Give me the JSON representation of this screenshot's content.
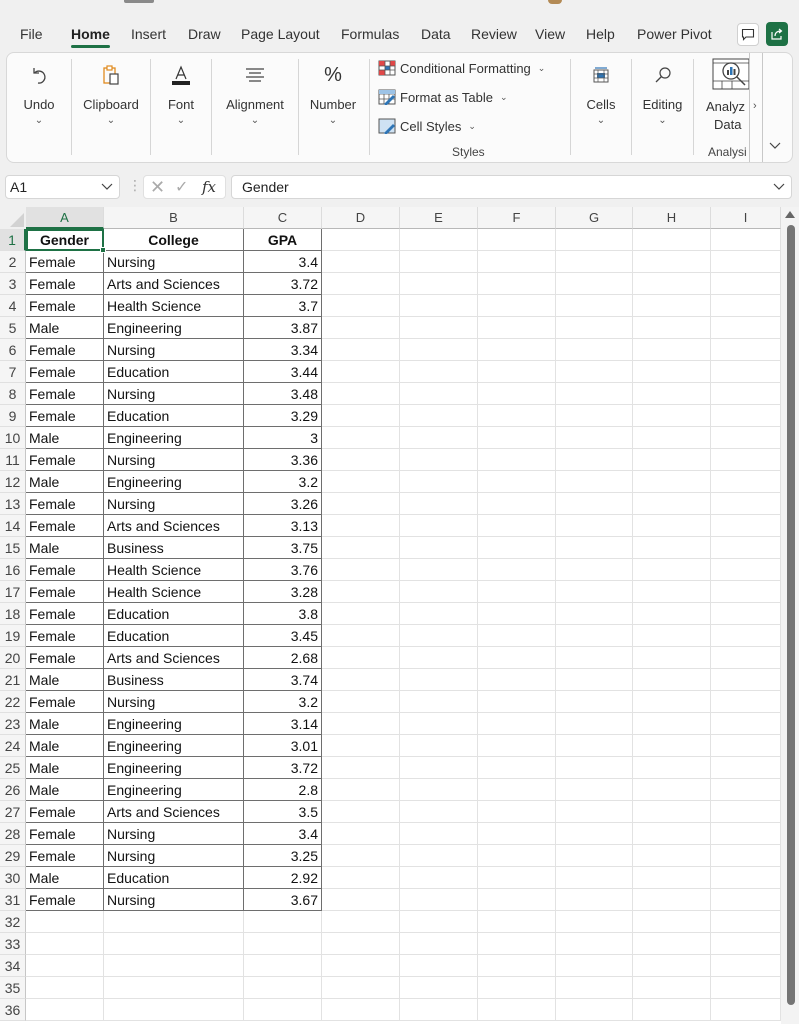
{
  "menu": {
    "tabs": [
      "File",
      "Home",
      "Insert",
      "Draw",
      "Page Layout",
      "Formulas",
      "Data",
      "Review",
      "View",
      "Help",
      "Power Pivot"
    ],
    "active_tab": "Home",
    "comment_icon": "comment-icon",
    "share_icon": "share-icon"
  },
  "ribbon": {
    "undo": "Undo",
    "clipboard": "Clipboard",
    "font": "Font",
    "alignment": "Alignment",
    "number": "Number",
    "number_icon": "%",
    "conditional_formatting": "Conditional Formatting",
    "format_as_table": "Format as Table",
    "cell_styles": "Cell Styles",
    "styles_caption": "Styles",
    "cells": "Cells",
    "editing": "Editing",
    "analyze_data_line1": "Analyz",
    "analyze_data_line2": "Data",
    "analysis_caption": "Analysi",
    "chevron": "⌄",
    "expand_chevron": "›",
    "collapse_chevron": "⌄"
  },
  "formula_bar": {
    "name_box": "A1",
    "fx_label": "fx",
    "value": "Gender"
  },
  "sheet": {
    "columns": [
      "A",
      "B",
      "C",
      "D",
      "E",
      "F",
      "G",
      "H",
      "I"
    ],
    "active_cell": "A1",
    "headers": [
      "Gender",
      "College",
      "GPA"
    ],
    "rows": [
      [
        "Female",
        "Nursing",
        "3.4"
      ],
      [
        "Female",
        "Arts and Sciences",
        "3.72"
      ],
      [
        "Female",
        "Health Science",
        "3.7"
      ],
      [
        "Male",
        "Engineering",
        "3.87"
      ],
      [
        "Female",
        "Nursing",
        "3.34"
      ],
      [
        "Female",
        "Education",
        "3.44"
      ],
      [
        "Female",
        "Nursing",
        "3.48"
      ],
      [
        "Female",
        "Education",
        "3.29"
      ],
      [
        "Male",
        "Engineering",
        "3"
      ],
      [
        "Female",
        "Nursing",
        "3.36"
      ],
      [
        "Male",
        "Engineering",
        "3.2"
      ],
      [
        "Female",
        "Nursing",
        "3.26"
      ],
      [
        "Female",
        "Arts and Sciences",
        "3.13"
      ],
      [
        "Male",
        "Business",
        "3.75"
      ],
      [
        "Female",
        "Health Science",
        "3.76"
      ],
      [
        "Female",
        "Health Science",
        "3.28"
      ],
      [
        "Female",
        "Education",
        "3.8"
      ],
      [
        "Female",
        "Education",
        "3.45"
      ],
      [
        "Female",
        "Arts and Sciences",
        "2.68"
      ],
      [
        "Male",
        "Business",
        "3.74"
      ],
      [
        "Female",
        "Nursing",
        "3.2"
      ],
      [
        "Male",
        "Engineering",
        "3.14"
      ],
      [
        "Male",
        "Engineering",
        "3.01"
      ],
      [
        "Male",
        "Engineering",
        "3.72"
      ],
      [
        "Male",
        "Engineering",
        "2.8"
      ],
      [
        "Female",
        "Arts and Sciences",
        "3.5"
      ],
      [
        "Female",
        "Nursing",
        "3.4"
      ],
      [
        "Female",
        "Nursing",
        "3.25"
      ],
      [
        "Male",
        "Education",
        "2.92"
      ],
      [
        "Female",
        "Nursing",
        "3.67"
      ]
    ],
    "visible_row_numbers": [
      1,
      2,
      3,
      4,
      5,
      6,
      7,
      8,
      9,
      10,
      11,
      12,
      13,
      14,
      15,
      16,
      17,
      18,
      19,
      20,
      21,
      22,
      23,
      24,
      25,
      26,
      27,
      28,
      29,
      30,
      31,
      32,
      33,
      34,
      35,
      36
    ]
  },
  "colors": {
    "accent": "#1e7145",
    "conditional_red": "#e04848",
    "table_blue": "#2e75b6"
  }
}
